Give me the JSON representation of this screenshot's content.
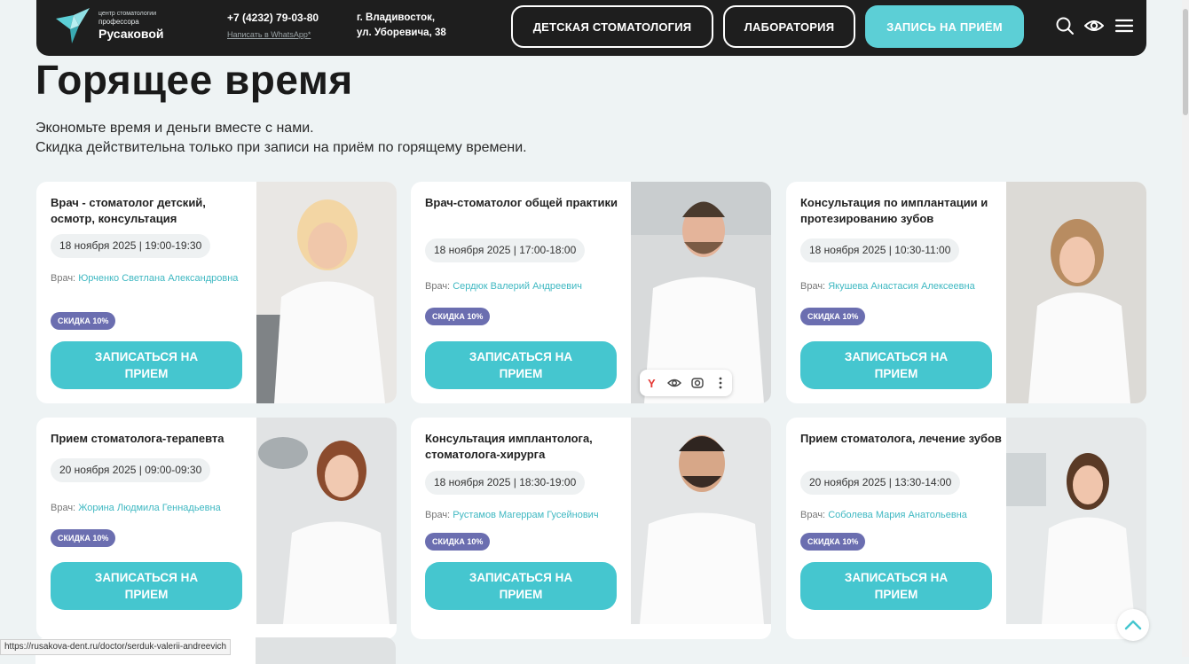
{
  "header": {
    "logo": {
      "line1": "центр стоматологии",
      "line2": "профессора",
      "line3": "Русаковой"
    },
    "phone": "+7 (4232) 79-03-80",
    "whatsapp": "Написать в WhatsApp*",
    "address_line1": "г. Владивосток,",
    "address_line2": "ул. Уборевича, 38",
    "nav": {
      "kids": "ДЕТСКАЯ СТОМАТОЛОГИЯ",
      "lab": "ЛАБОРАТОРИЯ",
      "booking": "ЗАПИСЬ НА ПРИЁМ"
    },
    "icons": [
      "search-icon",
      "eye-icon",
      "menu-icon"
    ],
    "colors": {
      "background": "#1e1e1e",
      "accent": "#5ccfd6"
    }
  },
  "page": {
    "title": "Горящее время",
    "intro_line1": "Экономьте время и деньги вместе с нами.",
    "intro_line2": "Скидка действительна только при записи на приём по горящему времени."
  },
  "cards": [
    {
      "title": "Врач - стоматолог детский, осмотр, консультация",
      "date": "18 ноября 2025 | 19:00-19:30",
      "doctor_prefix": "Врач:",
      "doctor": "Юрченко Светлана Александровна",
      "discount": "СКИДКА 10%",
      "button": "ЗАПИСАТЬСЯ НА ПРИЕМ"
    },
    {
      "title": "Врач-стоматолог общей практики",
      "date": "18 ноября 2025 | 17:00-18:00",
      "doctor_prefix": "Врач:",
      "doctor": "Сердюк Валерий Андреевич",
      "discount": "СКИДКА 10%",
      "button": "ЗАПИСАТЬСЯ НА ПРИЕМ"
    },
    {
      "title": "Консультация по имплантации и протезированию зубов",
      "date": "18 ноября 2025 | 10:30-11:00",
      "doctor_prefix": "Врач:",
      "doctor": "Якушева Анастасия Алексеевна",
      "discount": "СКИДКА 10%",
      "button": "ЗАПИСАТЬСЯ НА ПРИЕМ"
    },
    {
      "title": "Прием стоматолога-терапевта",
      "date": "20 ноября 2025 | 09:00-09:30",
      "doctor_prefix": "Врач:",
      "doctor": "Жорина Людмила Геннадьевна",
      "discount": "СКИДКА 10%",
      "button": "ЗАПИСАТЬСЯ НА ПРИЕМ"
    },
    {
      "title": "Консультация имплантолога, стоматолога-хирурга",
      "date": "18 ноября 2025 | 18:30-19:00",
      "doctor_prefix": "Врач:",
      "doctor": "Рустамов Магеррам Гусейнович",
      "discount": "СКИДКА 10%",
      "button": "ЗАПИСАТЬСЯ НА ПРИЕМ"
    },
    {
      "title": "Прием стоматолога, лечение зубов",
      "date": "20 ноября 2025 | 13:30-14:00",
      "doctor_prefix": "Врач:",
      "doctor": "Соболева Мария Анатольевна",
      "discount": "СКИДКА 10%",
      "button": "ЗАПИСАТЬСЯ НА ПРИЕМ"
    }
  ],
  "image_toolbar": {
    "icons": [
      "yandex-icon",
      "eye-icon",
      "lens-icon",
      "more-icon"
    ]
  },
  "status_url": "https://rusakova-dent.ru/doctor/serduk-valerii-andreevich",
  "colors": {
    "button": "#45c6cf",
    "discount_badge": "#6b6eb0",
    "doctor_link": "#3fb8c2",
    "page_bg": "#eef3f4"
  }
}
